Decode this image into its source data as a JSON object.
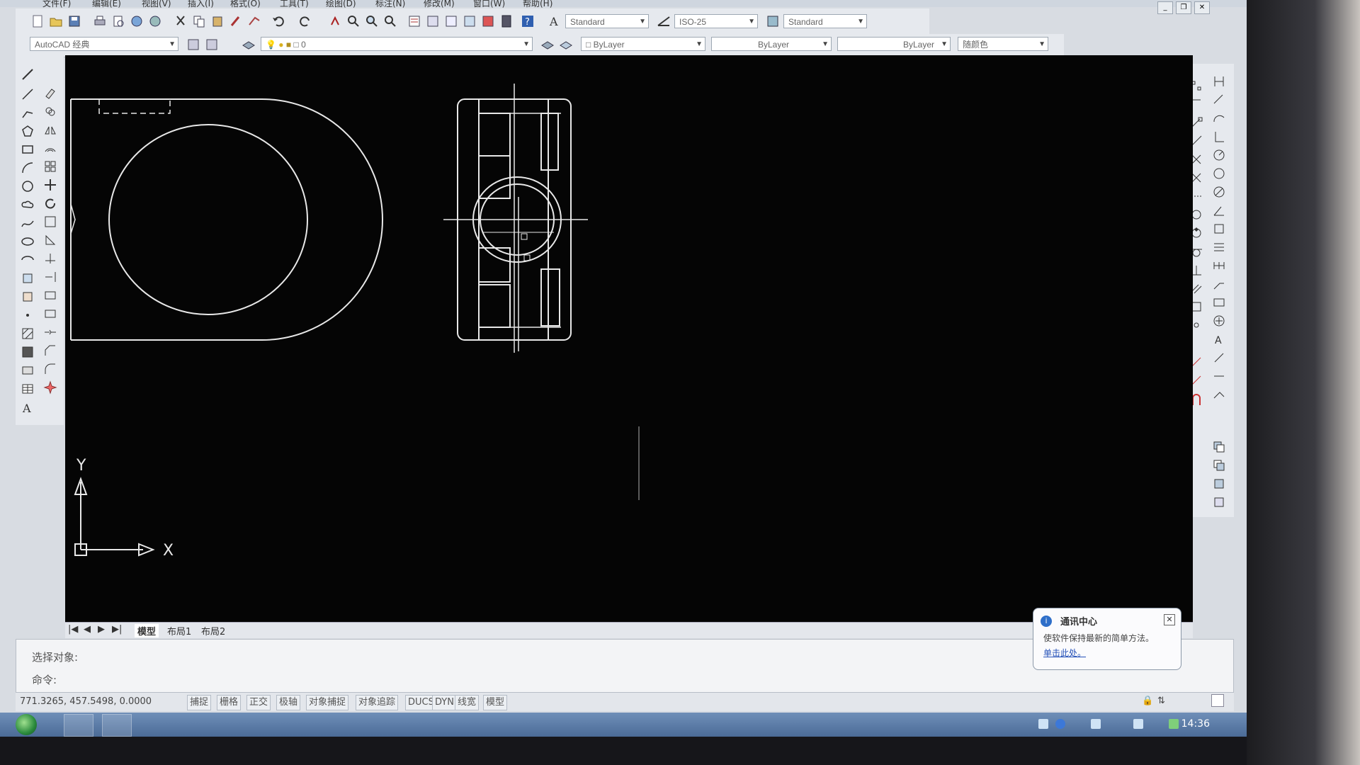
{
  "menu": {
    "items": [
      "文件(F)",
      "编辑(E)",
      "视图(V)",
      "插入(I)",
      "格式(O)",
      "工具(T)",
      "绘图(D)",
      "标注(N)",
      "修改(M)",
      "窗口(W)",
      "帮助(H)"
    ]
  },
  "toolbar": {
    "text_style": "Standard",
    "dim_style": "ISO-25",
    "table_style": "Standard",
    "workspace": "AutoCAD 经典",
    "layer": "0",
    "color": "ByLayer",
    "linetype": "ByLayer",
    "lineweight": "ByLayer",
    "plot_style": "随颜色"
  },
  "ucs": {
    "y_label": "Y",
    "x_label": "X"
  },
  "tabs": {
    "model": "模型",
    "layout1": "布局1",
    "layout2": "布局2"
  },
  "command": {
    "line1": "选择对象:",
    "line2": "命令:"
  },
  "status": {
    "coords": "771.3265, 457.5498, 0.0000",
    "buttons": [
      "捕捉",
      "栅格",
      "正交",
      "极轴",
      "对象捕捉",
      "对象追踪",
      "DUCS",
      "DYN",
      "线宽",
      "模型"
    ]
  },
  "balloon": {
    "title": "通讯中心",
    "message": "使软件保持最新的简单方法。",
    "link": "单击此处。"
  },
  "taskbar": {
    "time": "14:36"
  },
  "colors": {
    "canvas": "#050505",
    "drawing": "#e8e8e8",
    "accent": "#2f6fc9"
  }
}
